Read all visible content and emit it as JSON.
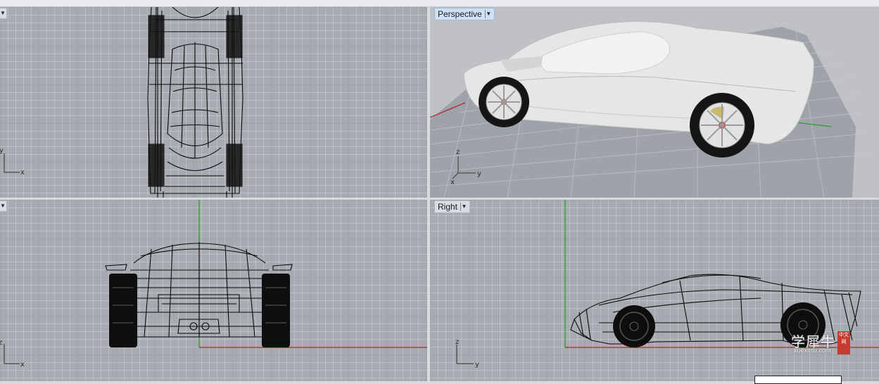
{
  "viewports": {
    "top": {
      "axis_x": "x",
      "axis_y": "y"
    },
    "perspective": {
      "label": "Perspective",
      "axis_x": "x",
      "axis_y": "y",
      "axis_z": "z"
    },
    "front": {
      "axis_x": "x",
      "axis_z": "z"
    },
    "right": {
      "label": "Right",
      "axis_y": "y",
      "axis_z": "z"
    }
  },
  "watermark": {
    "text": "学犀牛",
    "url": "xuexiniu.com",
    "badge": "中文网"
  },
  "icons": {
    "dropdown": "chevron-down-icon"
  },
  "colors": {
    "x_axis": "#b02020",
    "y_axis": "#2a9a2a",
    "grid_bg": "#a6aab1",
    "active_label": "#cfe0f4"
  }
}
